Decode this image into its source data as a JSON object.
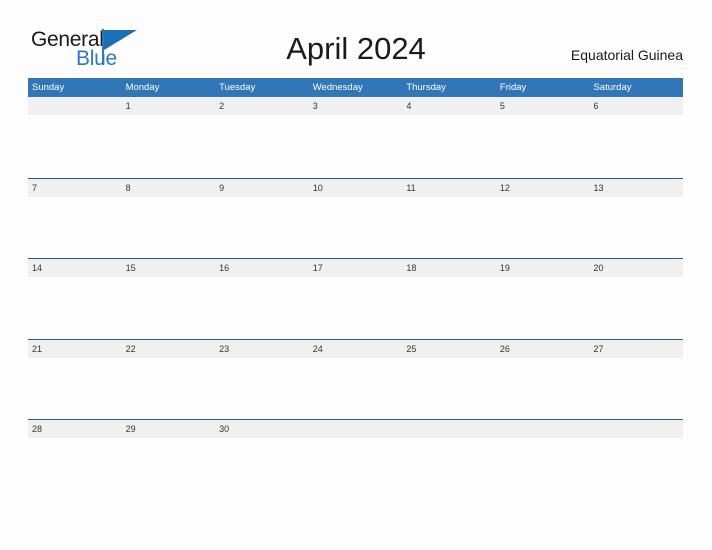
{
  "brand": {
    "name_part1": "General",
    "name_part2": "Blue",
    "flag_icon": "blue-flag-triangle-icon",
    "color_primary": "#2f78bd",
    "color_dark": "#1a1a1a"
  },
  "header": {
    "title": "April 2024",
    "country": "Equatorial Guinea"
  },
  "calendar": {
    "month": "April",
    "year": "2024",
    "accent_color": "#3177b8",
    "divider_color": "#1f5c96",
    "band_color": "#f0f0f0",
    "weekdays": [
      "Sunday",
      "Monday",
      "Tuesday",
      "Wednesday",
      "Thursday",
      "Friday",
      "Saturday"
    ],
    "weeks": [
      [
        "",
        "1",
        "2",
        "3",
        "4",
        "5",
        "6"
      ],
      [
        "7",
        "8",
        "9",
        "10",
        "11",
        "12",
        "13"
      ],
      [
        "14",
        "15",
        "16",
        "17",
        "18",
        "19",
        "20"
      ],
      [
        "21",
        "22",
        "23",
        "24",
        "25",
        "26",
        "27"
      ],
      [
        "28",
        "29",
        "30",
        "",
        "",
        "",
        ""
      ]
    ]
  }
}
